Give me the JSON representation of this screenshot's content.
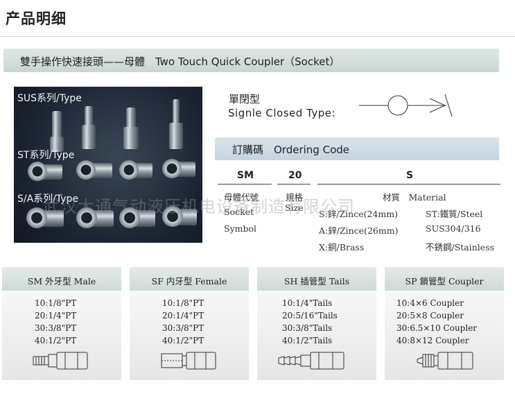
{
  "header": {
    "title": "产品明细"
  },
  "banner": {
    "title": "雙手操作快速接頭——母體　Two Touch Quick Coupler（Socket）"
  },
  "photo": {
    "labels": [
      "SUS系列/Type",
      "ST系列/Type",
      "S/A系列/Type"
    ]
  },
  "closed_type": {
    "cn": "單閉型",
    "en": "Signle Closed Type:"
  },
  "ordering": {
    "title": "訂購碼　Ordering Code",
    "codes": [
      "SM",
      "20",
      "S"
    ],
    "socket_symbol": {
      "cn": "母體代號",
      "en1": "Socket",
      "en2": "Symbol"
    },
    "size": {
      "cn": "規格",
      "en": "Size"
    },
    "material": {
      "title": "材質　Material",
      "items": [
        "S:鋅/Zince(24mm)",
        "ST:鐵質/Steel",
        "A:鋅/Zince(26mm)",
        "SUS304/316",
        "X:銅/Brass",
        "不銹鋼/Stainless"
      ]
    }
  },
  "watermark": "武汉大通气动液压机电设备制造有限公司",
  "cards": [
    {
      "title": "SM 外牙型 Male",
      "lines": [
        "10:1/8\"PT",
        "20:1/4\"PT",
        "30:3/8\"PT",
        "40:1/2\"PT"
      ]
    },
    {
      "title": "SF 内牙型 Female",
      "lines": [
        "10:1/8\"PT",
        "20:1/4\"PT",
        "30:3/8\"PT",
        "40:1/2\"PT"
      ]
    },
    {
      "title": "SH 插管型 Tails",
      "lines": [
        "10:1/4\"Tails",
        "20:5/16\"Tails",
        "30:3/8\"Tails",
        "40:1/2\"Tails"
      ]
    },
    {
      "title": "SP 鎖管型 Coupler",
      "lines": [
        "10:4×6 Coupler",
        "20:5×8 Coupler",
        "30:6.5×10 Coupler",
        "40:8×12 Coupler"
      ]
    }
  ]
}
